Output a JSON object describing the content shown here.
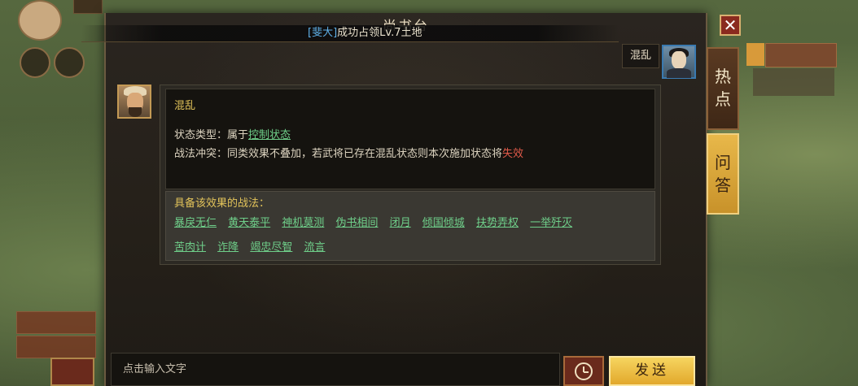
{
  "panel": {
    "title": "尚书台",
    "notice": {
      "name": "[斐大]",
      "text": "成功占领Lv.7土地"
    }
  },
  "user": {
    "message": "混乱"
  },
  "bot": {
    "title": "混乱",
    "line1_prefix": "状态类型：属于",
    "line1_link": "控制状态",
    "line2_prefix": "战法冲突：同类效果不叠加，若武将已存在混乱状态则本次施加状态将",
    "line2_red": "失效",
    "skills_title": "具备该效果的战法：",
    "skills": [
      "暴戾无仁",
      "黄天泰平",
      "神机莫测",
      "伪书相间",
      "闭月",
      "倾国倾城",
      "扶势弄权",
      "一举歼灭",
      "苦肉计",
      "诈降",
      "竭忠尽智",
      "流言"
    ]
  },
  "tabs": {
    "hot": [
      "热",
      "点"
    ],
    "qa": [
      "问",
      "答"
    ]
  },
  "input": {
    "placeholder": "点击输入文字"
  },
  "buttons": {
    "close": "✕",
    "send": "发送"
  },
  "colors": {
    "link": "#6fcf8a",
    "warning": "#e05a4a",
    "title_gold": "#e2c35a",
    "send_button": "#e2a82c"
  }
}
